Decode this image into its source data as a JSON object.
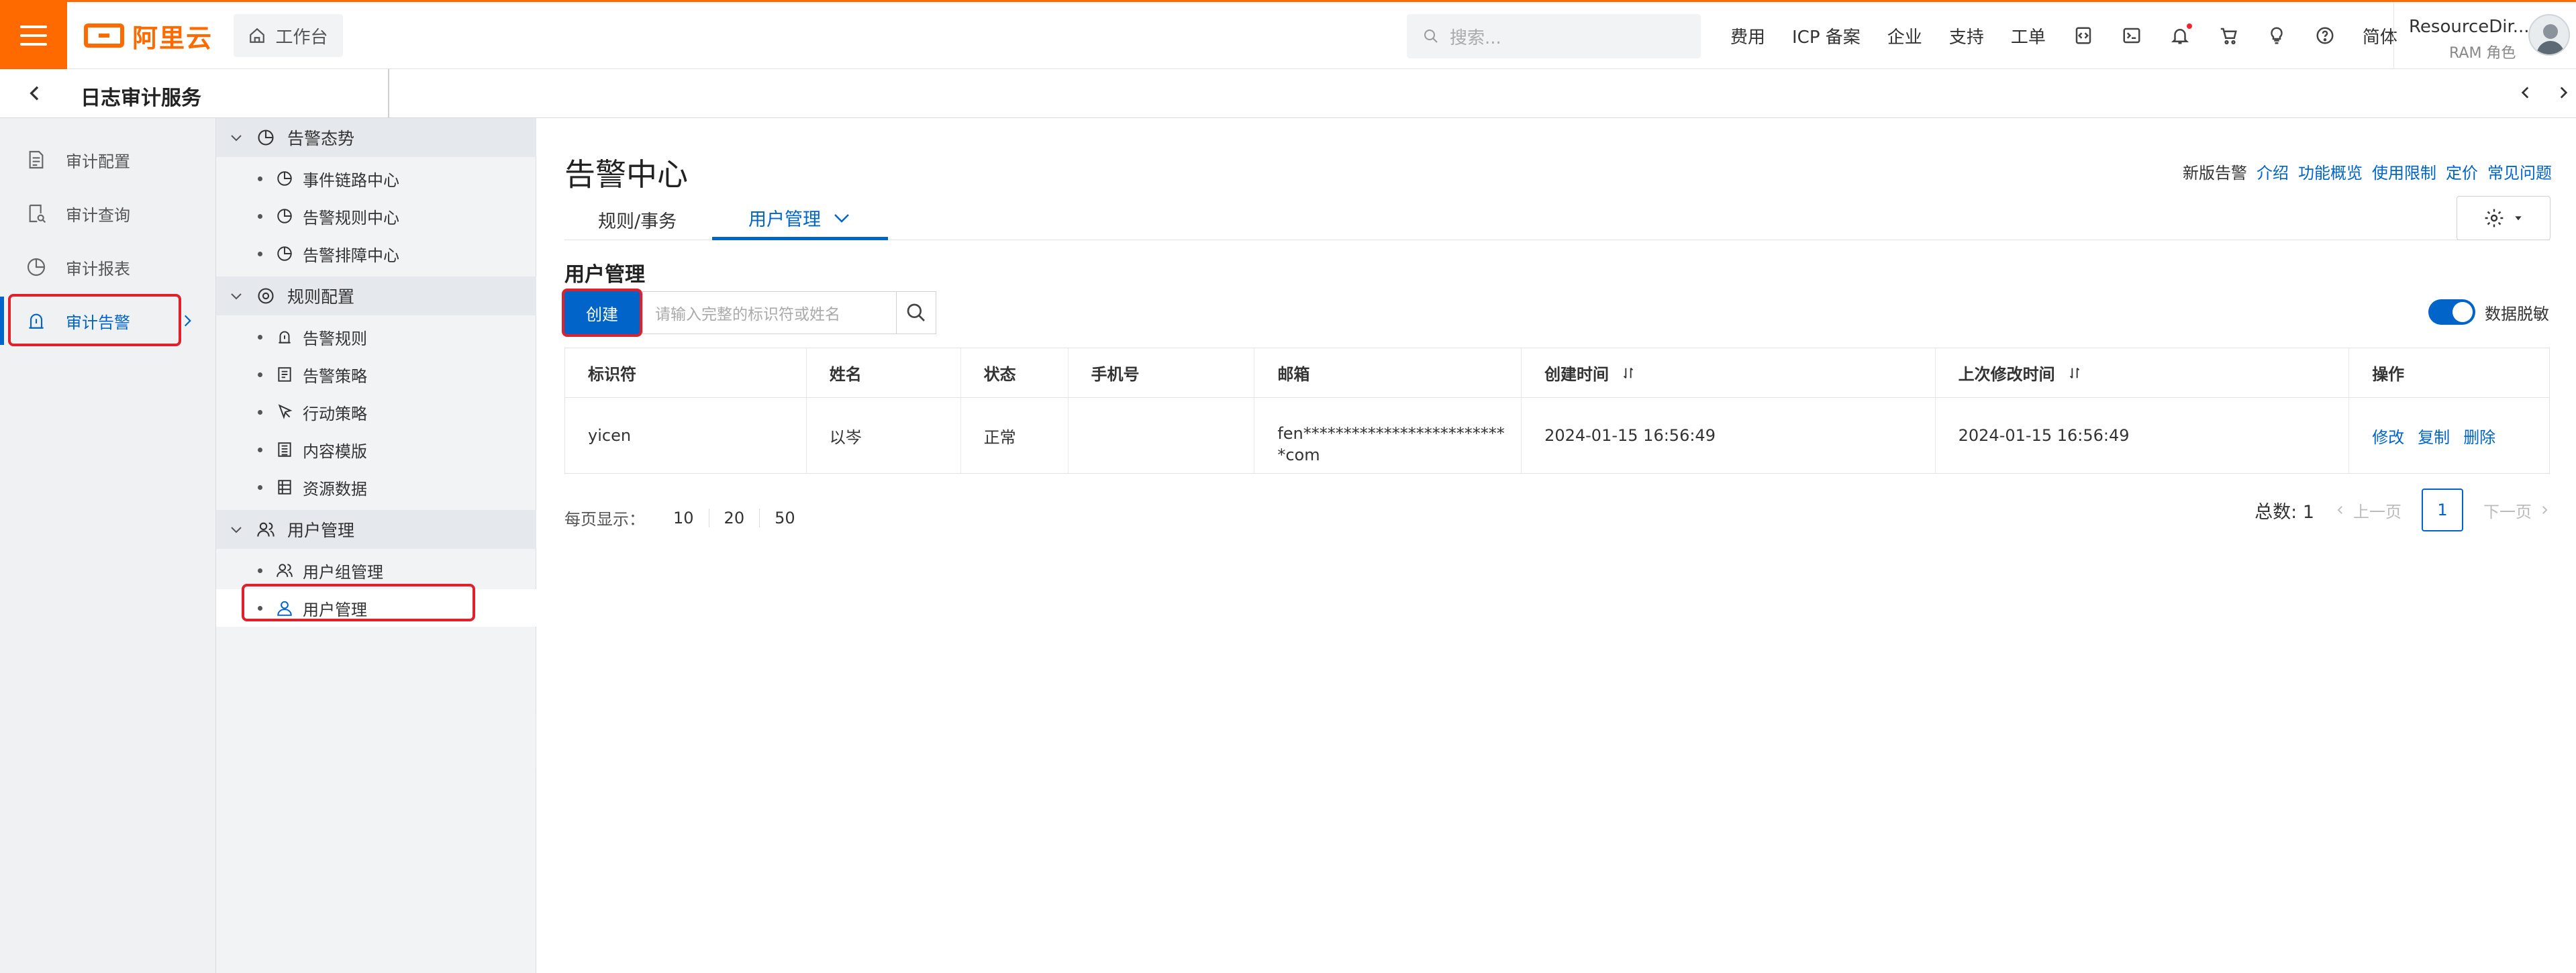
{
  "topbar": {
    "brand": "阿里云",
    "workbench": "工作台",
    "search_placeholder": "搜索...",
    "nav": [
      "费用",
      "ICP 备案",
      "企业",
      "支持",
      "工单"
    ],
    "lang": "简体",
    "account_name": "ResourceDir...",
    "account_role": "RAM 角色",
    "brand_color": "#ff6a00"
  },
  "secondbar": {
    "title": "日志审计服务"
  },
  "sidebar": {
    "items": [
      {
        "label": "审计配置",
        "icon": "config-icon"
      },
      {
        "label": "审计查询",
        "icon": "query-icon"
      },
      {
        "label": "审计报表",
        "icon": "report-icon"
      },
      {
        "label": "审计告警",
        "icon": "alert-icon",
        "active": true
      }
    ]
  },
  "submenu": {
    "groups": [
      {
        "label": "告警态势",
        "items": [
          "事件链路中心",
          "告警规则中心",
          "告警排障中心"
        ]
      },
      {
        "label": "规则配置",
        "items": [
          "告警规则",
          "告警策略",
          "行动策略",
          "内容模版",
          "资源数据"
        ]
      },
      {
        "label": "用户管理",
        "items": [
          "用户组管理",
          "用户管理"
        ]
      }
    ],
    "selected": "用户管理"
  },
  "main": {
    "title": "告警中心",
    "help_plain": "新版告警",
    "help_links": [
      "介绍",
      "功能概览",
      "使用限制",
      "定价",
      "常见问题"
    ],
    "tabs": [
      "规则/事务",
      "用户管理"
    ],
    "section_title": "用户管理",
    "create_label": "创建",
    "search_placeholder": "请输入完整的标识符或姓名",
    "toggle_label": "数据脱敏",
    "toggle_on": true,
    "columns": [
      "标识符",
      "姓名",
      "状态",
      "手机号",
      "邮箱",
      "创建时间",
      "上次修改时间",
      "操作"
    ],
    "rows": [
      {
        "id": "yicen",
        "name": "以岑",
        "status": "正常",
        "phone": "",
        "email": "fen**************************com",
        "created": "2024-01-15 16:56:49",
        "modified": "2024-01-15 16:56:49",
        "ops": [
          "修改",
          "复制",
          "删除"
        ]
      }
    ],
    "page_size_label": "每页显示：",
    "page_sizes": [
      "10",
      "20",
      "50"
    ],
    "total": "总数: 1",
    "prev": "上一页",
    "next": "下一页",
    "current_page": "1",
    "accent": "#0064c8"
  }
}
